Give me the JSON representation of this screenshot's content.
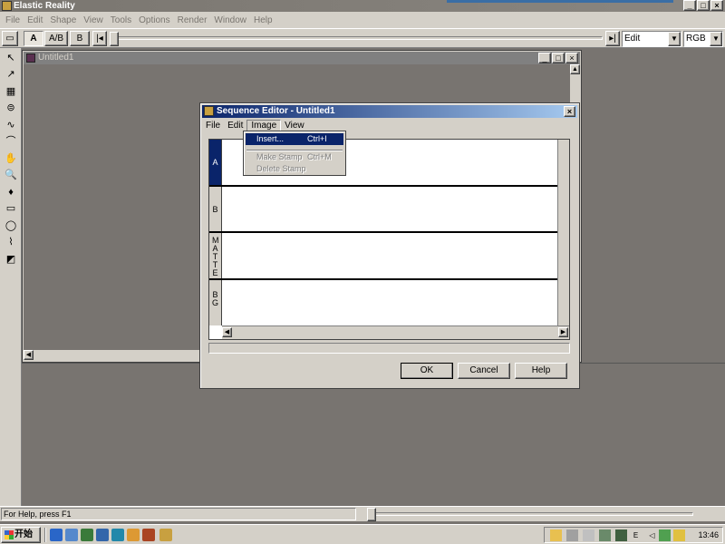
{
  "app": {
    "title": "Elastic Reality",
    "window_controls": [
      "_",
      "□",
      "×"
    ]
  },
  "menubar": {
    "items": [
      "File",
      "Edit",
      "Shape",
      "View",
      "Tools",
      "Options",
      "Render",
      "Window",
      "Help"
    ]
  },
  "toolbar": {
    "buttons": [
      "A",
      "A/B",
      "B"
    ],
    "mode_select": "Edit",
    "color_select": "RGB"
  },
  "tools": {
    "items": [
      "select-arrow",
      "bezier-pen",
      "grid",
      "cylinder",
      "curve",
      "spline",
      "hand",
      "zoom",
      "dropper",
      "rectangle",
      "ellipse",
      "stamp",
      "paint"
    ]
  },
  "document": {
    "title": "Untitled1"
  },
  "sequence_editor": {
    "title": "Sequence Editor - Untitled1",
    "menu": [
      "File",
      "Edit",
      "Image",
      "View"
    ],
    "tracks": [
      "A",
      "B",
      "MATTE",
      "BG"
    ],
    "buttons": {
      "ok": "OK",
      "cancel": "Cancel",
      "help": "Help"
    }
  },
  "image_menu": {
    "items": [
      {
        "label": "Insert...",
        "accel": "Ctrl+I",
        "state": "highlighted"
      },
      {
        "label": "Make Stamp",
        "accel": "Ctrl+M",
        "state": "disabled"
      },
      {
        "label": "Delete Stamp",
        "accel": "",
        "state": "disabled"
      }
    ]
  },
  "status": {
    "text": "For Help, press F1"
  },
  "taskbar": {
    "start": "开始",
    "clock": "13:46",
    "tray_letter": "E"
  },
  "colors": {
    "desktop": "#787470",
    "face": "#d4d0c8",
    "active_title": "#0a246a",
    "highlight": "#0a246a"
  }
}
